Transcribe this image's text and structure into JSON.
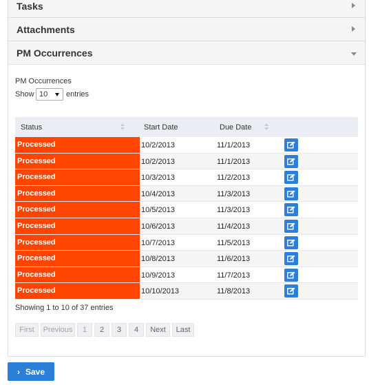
{
  "sections": {
    "tasks": "Tasks",
    "attachments": "Attachments",
    "pm_occurrences": "PM Occurrences"
  },
  "subtitle": "PM Occurrences",
  "length_menu": {
    "show": "Show",
    "value": "10",
    "entries": "entries"
  },
  "table": {
    "headers": {
      "status": "Status",
      "start": "Start Date",
      "due": "Due Date"
    },
    "status_color": "#ff4500",
    "rows": [
      {
        "status": "Processed",
        "start": "10/2/2013",
        "due": "11/1/2013"
      },
      {
        "status": "Processed",
        "start": "10/2/2013",
        "due": "11/1/2013"
      },
      {
        "status": "Processed",
        "start": "10/3/2013",
        "due": "11/2/2013"
      },
      {
        "status": "Processed",
        "start": "10/4/2013",
        "due": "11/3/2013"
      },
      {
        "status": "Processed",
        "start": "10/5/2013",
        "due": "11/3/2013"
      },
      {
        "status": "Processed",
        "start": "10/6/2013",
        "due": "11/4/2013"
      },
      {
        "status": "Processed",
        "start": "10/7/2013",
        "due": "11/5/2013"
      },
      {
        "status": "Processed",
        "start": "10/8/2013",
        "due": "11/6/2013"
      },
      {
        "status": "Processed",
        "start": "10/9/2013",
        "due": "11/7/2013"
      },
      {
        "status": "Processed",
        "start": "10/10/2013",
        "due": "11/8/2013"
      }
    ]
  },
  "info": "Showing 1 to 10 of 37 entries",
  "pager": {
    "first": "First",
    "previous": "Previous",
    "p1": "1",
    "p2": "2",
    "p3": "3",
    "p4": "4",
    "next": "Next",
    "last": "Last"
  },
  "save": {
    "chevron": "›",
    "label": "Save",
    "color": "#2a7fd8"
  }
}
